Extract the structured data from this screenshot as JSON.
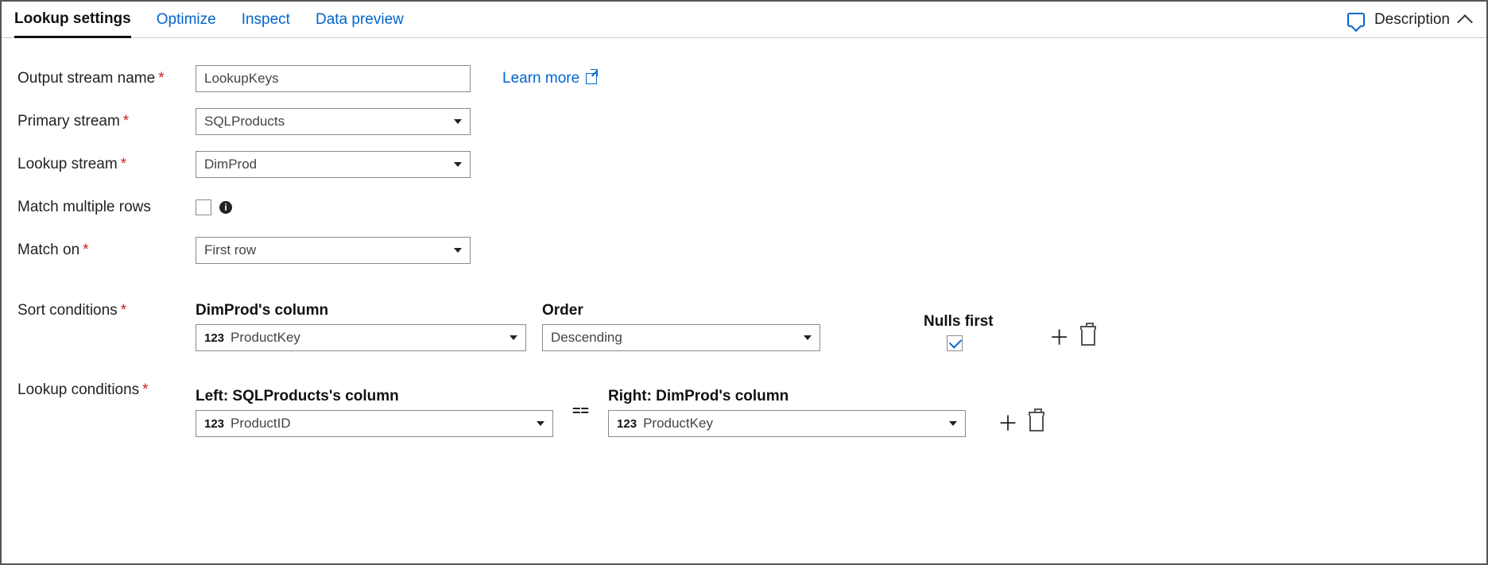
{
  "tabs": {
    "items": [
      "Lookup settings",
      "Optimize",
      "Inspect",
      "Data preview"
    ],
    "active": "Lookup settings"
  },
  "header_right": {
    "description_label": "Description"
  },
  "form": {
    "output_stream_name": {
      "label": "Output stream name",
      "value": "LookupKeys"
    },
    "primary_stream": {
      "label": "Primary stream",
      "value": "SQLProducts"
    },
    "lookup_stream": {
      "label": "Lookup stream",
      "value": "DimProd"
    },
    "match_multiple": {
      "label": "Match multiple rows",
      "checked": false
    },
    "match_on": {
      "label": "Match on",
      "value": "First row"
    },
    "learn_more": "Learn more"
  },
  "sort": {
    "section_label": "Sort conditions",
    "column_header": "DimProd's column",
    "order_header": "Order",
    "nulls_header": "Nulls first",
    "row": {
      "type_badge": "123",
      "column": "ProductKey",
      "order": "Descending",
      "nulls_first": true
    }
  },
  "lookup": {
    "section_label": "Lookup conditions",
    "left_header": "Left: SQLProducts's column",
    "right_header": "Right: DimProd's column",
    "operator": "==",
    "row": {
      "type_badge": "123",
      "left": "ProductID",
      "right": "ProductKey"
    }
  }
}
